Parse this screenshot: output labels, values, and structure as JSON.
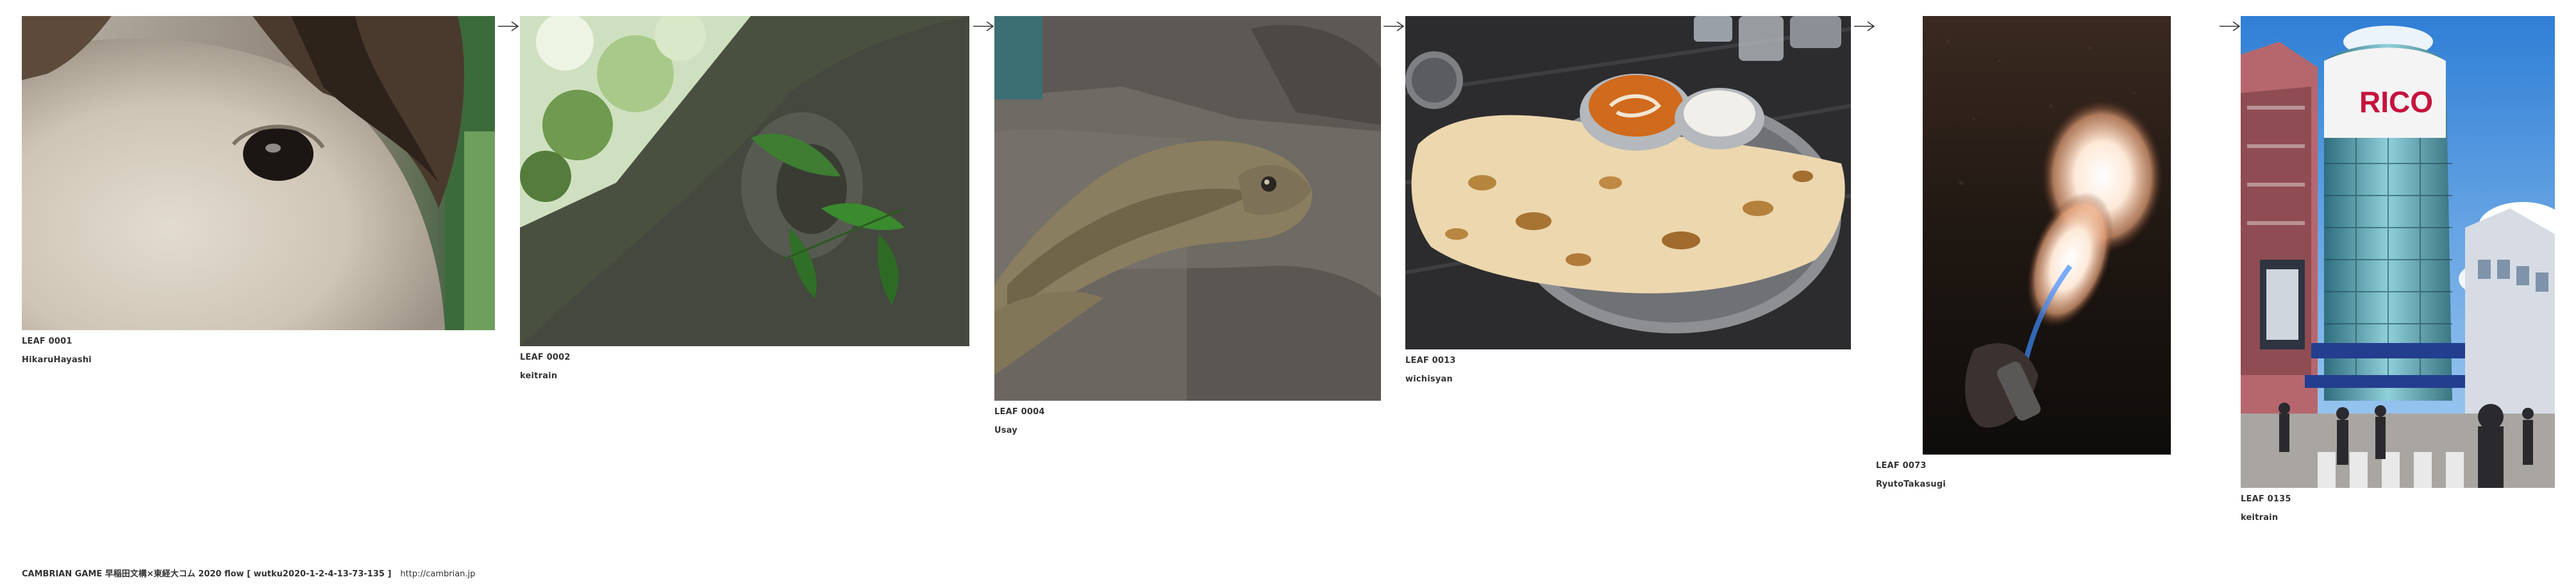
{
  "leaves": [
    {
      "leaf_label": "LEAF 0001",
      "author": "HikaruHayashi"
    },
    {
      "leaf_label": "LEAF 0002",
      "author": "keitrain"
    },
    {
      "leaf_label": "LEAF 0004",
      "author": "Usay"
    },
    {
      "leaf_label": "LEAF 0013",
      "author": "wichisyan"
    },
    {
      "leaf_label": "LEAF 0073",
      "author": "RyutoTakasugi"
    },
    {
      "leaf_label": "LEAF 0135",
      "author": "keitrain"
    }
  ],
  "footer": {
    "text": "CAMBRIAN GAME  早稲田文構×東経大コム 2020  flow [ wutku2020-1-2-4-13-73-135 ]",
    "url": "http://cambrian.jp"
  },
  "icons": {
    "arrow": "arrow-right-icon"
  }
}
